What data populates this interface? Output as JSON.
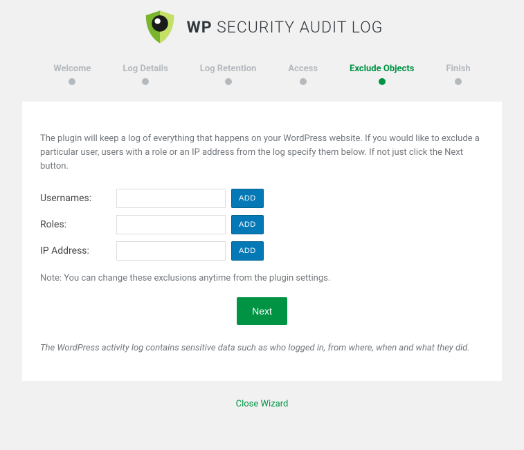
{
  "logo": {
    "text_bold": "WP",
    "text_rest": " SECURITY AUDIT LOG"
  },
  "steps": [
    {
      "label": "Welcome",
      "active": false
    },
    {
      "label": "Log Details",
      "active": false
    },
    {
      "label": "Log Retention",
      "active": false
    },
    {
      "label": "Access",
      "active": false
    },
    {
      "label": "Exclude Objects",
      "active": true
    },
    {
      "label": "Finish",
      "active": false
    }
  ],
  "intro": "The plugin will keep a log of everything that happens on your WordPress website. If you would like to exclude a particular user, users with a role or an IP address from the log specify them below. If not just click the Next button.",
  "fields": {
    "usernames": {
      "label": "Usernames:",
      "value": "",
      "add": "ADD"
    },
    "roles": {
      "label": "Roles:",
      "value": "",
      "add": "ADD"
    },
    "ip": {
      "label": "IP Address:",
      "value": "",
      "add": "ADD"
    }
  },
  "note": "Note: You can change these exclusions anytime from the plugin settings.",
  "next_label": "Next",
  "footnote": "The WordPress activity log contains sensitive data such as who logged in, from where, when and what they did.",
  "close_label": "Close Wizard"
}
